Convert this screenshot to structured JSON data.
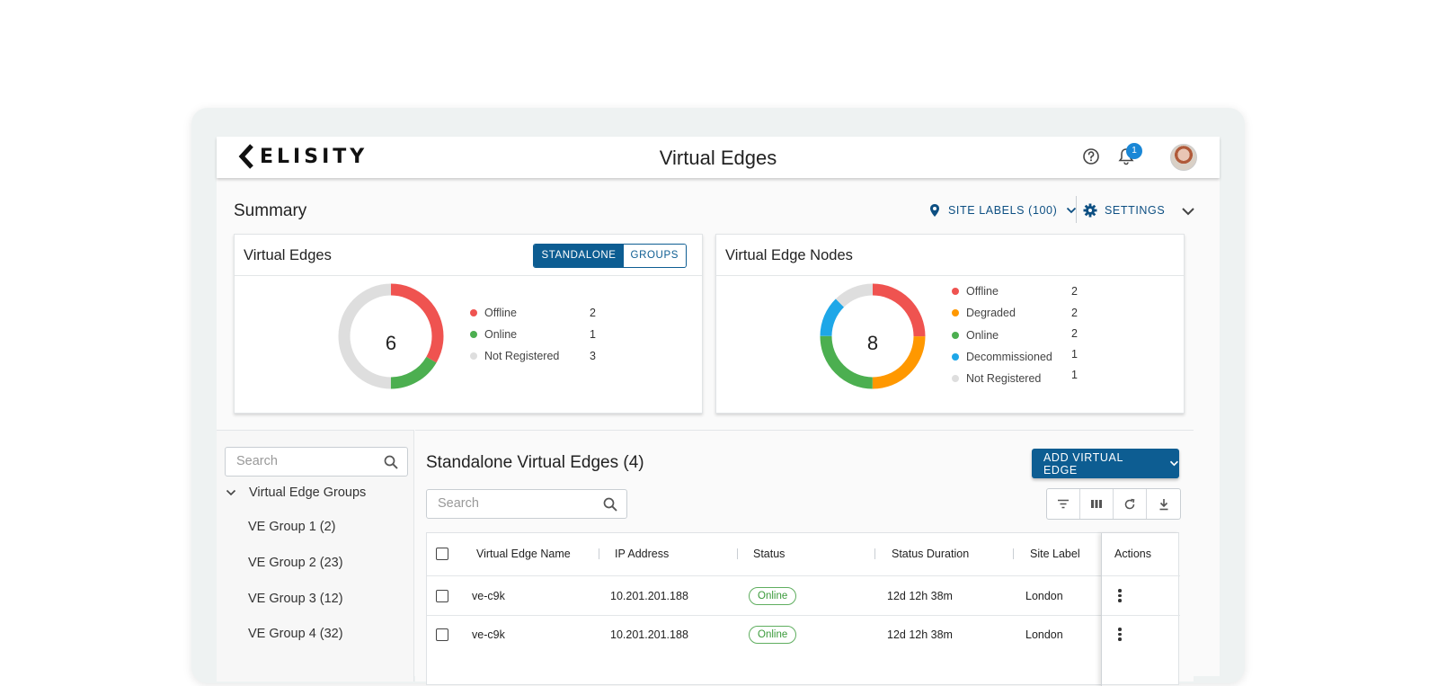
{
  "app": {
    "brand": "ELISITY",
    "page_title": "Virtual Edges",
    "notification_count": "1",
    "icons": {
      "help": "help-circle-icon",
      "notifications": "bell-icon",
      "avatar": "user-avatar"
    }
  },
  "summary": {
    "title": "Summary",
    "site_labels": "SITE LABELS (100)",
    "settings": "SETTINGS",
    "colors": {
      "offline": "#ef5350",
      "online": "#4caf50",
      "not_registered": "#dedede",
      "degraded": "#ff9800",
      "decommissioned": "#1ea7e8",
      "accent": "#0d5d92"
    }
  },
  "virtual_edges_card": {
    "title": "Virtual Edges",
    "toggle": [
      "STANDALONE",
      "GROUPS"
    ],
    "toggle_selected": "STANDALONE",
    "total": "6",
    "legend": [
      {
        "label": "Offline",
        "value": "2"
      },
      {
        "label": "Online",
        "value": "1"
      },
      {
        "label": "Not Registered",
        "value": "3"
      }
    ]
  },
  "nodes_card": {
    "title": "Virtual Edge Nodes",
    "total": "8",
    "legend": [
      {
        "label": "Offline",
        "value": "2"
      },
      {
        "label": "Degraded",
        "value": "2"
      },
      {
        "label": "Online",
        "value": "2"
      },
      {
        "label": "Decommissioned",
        "value": "1"
      },
      {
        "label": "Not Registered",
        "value": "1"
      }
    ]
  },
  "sidebar": {
    "search_placeholder": "Search",
    "root_label": "Virtual Edge Groups",
    "groups": [
      "VE Group 1 (2)",
      "VE Group 2 (23)",
      "VE Group 3 (12)",
      "VE Group 4 (32)"
    ]
  },
  "main": {
    "title": "Standalone Virtual Edges (4)",
    "add_button": "ADD VIRTUAL EDGE",
    "search_placeholder": "Search",
    "toolbar_icons": [
      "filter-icon",
      "columns-icon",
      "refresh-icon",
      "download-icon"
    ],
    "columns": [
      "Virtual Edge Name",
      "IP Address",
      "Status",
      "Status Duration",
      "Site Label",
      "Actions"
    ],
    "rows": [
      {
        "name": "ve-c9k",
        "ip": "10.201.201.188",
        "status": "Online",
        "duration": "12d 12h 38m",
        "site": "London"
      },
      {
        "name": "ve-c9k",
        "ip": "10.201.201.188",
        "status": "Online",
        "duration": "12d 12h 38m",
        "site": "London"
      }
    ]
  }
}
